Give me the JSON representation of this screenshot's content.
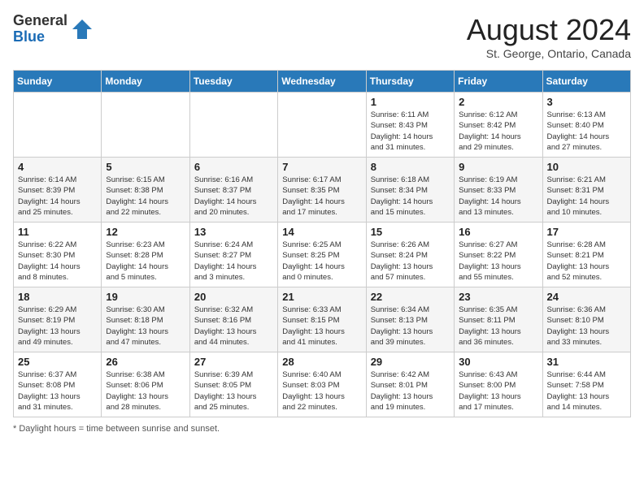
{
  "header": {
    "logo_general": "General",
    "logo_blue": "Blue",
    "month_title": "August 2024",
    "location": "St. George, Ontario, Canada"
  },
  "footer": {
    "note": "Daylight hours"
  },
  "days_of_week": [
    "Sunday",
    "Monday",
    "Tuesday",
    "Wednesday",
    "Thursday",
    "Friday",
    "Saturday"
  ],
  "weeks": [
    [
      {
        "day": "",
        "info": ""
      },
      {
        "day": "",
        "info": ""
      },
      {
        "day": "",
        "info": ""
      },
      {
        "day": "",
        "info": ""
      },
      {
        "day": "1",
        "info": "Sunrise: 6:11 AM\nSunset: 8:43 PM\nDaylight: 14 hours\nand 31 minutes."
      },
      {
        "day": "2",
        "info": "Sunrise: 6:12 AM\nSunset: 8:42 PM\nDaylight: 14 hours\nand 29 minutes."
      },
      {
        "day": "3",
        "info": "Sunrise: 6:13 AM\nSunset: 8:40 PM\nDaylight: 14 hours\nand 27 minutes."
      }
    ],
    [
      {
        "day": "4",
        "info": "Sunrise: 6:14 AM\nSunset: 8:39 PM\nDaylight: 14 hours\nand 25 minutes."
      },
      {
        "day": "5",
        "info": "Sunrise: 6:15 AM\nSunset: 8:38 PM\nDaylight: 14 hours\nand 22 minutes."
      },
      {
        "day": "6",
        "info": "Sunrise: 6:16 AM\nSunset: 8:37 PM\nDaylight: 14 hours\nand 20 minutes."
      },
      {
        "day": "7",
        "info": "Sunrise: 6:17 AM\nSunset: 8:35 PM\nDaylight: 14 hours\nand 17 minutes."
      },
      {
        "day": "8",
        "info": "Sunrise: 6:18 AM\nSunset: 8:34 PM\nDaylight: 14 hours\nand 15 minutes."
      },
      {
        "day": "9",
        "info": "Sunrise: 6:19 AM\nSunset: 8:33 PM\nDaylight: 14 hours\nand 13 minutes."
      },
      {
        "day": "10",
        "info": "Sunrise: 6:21 AM\nSunset: 8:31 PM\nDaylight: 14 hours\nand 10 minutes."
      }
    ],
    [
      {
        "day": "11",
        "info": "Sunrise: 6:22 AM\nSunset: 8:30 PM\nDaylight: 14 hours\nand 8 minutes."
      },
      {
        "day": "12",
        "info": "Sunrise: 6:23 AM\nSunset: 8:28 PM\nDaylight: 14 hours\nand 5 minutes."
      },
      {
        "day": "13",
        "info": "Sunrise: 6:24 AM\nSunset: 8:27 PM\nDaylight: 14 hours\nand 3 minutes."
      },
      {
        "day": "14",
        "info": "Sunrise: 6:25 AM\nSunset: 8:25 PM\nDaylight: 14 hours\nand 0 minutes."
      },
      {
        "day": "15",
        "info": "Sunrise: 6:26 AM\nSunset: 8:24 PM\nDaylight: 13 hours\nand 57 minutes."
      },
      {
        "day": "16",
        "info": "Sunrise: 6:27 AM\nSunset: 8:22 PM\nDaylight: 13 hours\nand 55 minutes."
      },
      {
        "day": "17",
        "info": "Sunrise: 6:28 AM\nSunset: 8:21 PM\nDaylight: 13 hours\nand 52 minutes."
      }
    ],
    [
      {
        "day": "18",
        "info": "Sunrise: 6:29 AM\nSunset: 8:19 PM\nDaylight: 13 hours\nand 49 minutes."
      },
      {
        "day": "19",
        "info": "Sunrise: 6:30 AM\nSunset: 8:18 PM\nDaylight: 13 hours\nand 47 minutes."
      },
      {
        "day": "20",
        "info": "Sunrise: 6:32 AM\nSunset: 8:16 PM\nDaylight: 13 hours\nand 44 minutes."
      },
      {
        "day": "21",
        "info": "Sunrise: 6:33 AM\nSunset: 8:15 PM\nDaylight: 13 hours\nand 41 minutes."
      },
      {
        "day": "22",
        "info": "Sunrise: 6:34 AM\nSunset: 8:13 PM\nDaylight: 13 hours\nand 39 minutes."
      },
      {
        "day": "23",
        "info": "Sunrise: 6:35 AM\nSunset: 8:11 PM\nDaylight: 13 hours\nand 36 minutes."
      },
      {
        "day": "24",
        "info": "Sunrise: 6:36 AM\nSunset: 8:10 PM\nDaylight: 13 hours\nand 33 minutes."
      }
    ],
    [
      {
        "day": "25",
        "info": "Sunrise: 6:37 AM\nSunset: 8:08 PM\nDaylight: 13 hours\nand 31 minutes."
      },
      {
        "day": "26",
        "info": "Sunrise: 6:38 AM\nSunset: 8:06 PM\nDaylight: 13 hours\nand 28 minutes."
      },
      {
        "day": "27",
        "info": "Sunrise: 6:39 AM\nSunset: 8:05 PM\nDaylight: 13 hours\nand 25 minutes."
      },
      {
        "day": "28",
        "info": "Sunrise: 6:40 AM\nSunset: 8:03 PM\nDaylight: 13 hours\nand 22 minutes."
      },
      {
        "day": "29",
        "info": "Sunrise: 6:42 AM\nSunset: 8:01 PM\nDaylight: 13 hours\nand 19 minutes."
      },
      {
        "day": "30",
        "info": "Sunrise: 6:43 AM\nSunset: 8:00 PM\nDaylight: 13 hours\nand 17 minutes."
      },
      {
        "day": "31",
        "info": "Sunrise: 6:44 AM\nSunset: 7:58 PM\nDaylight: 13 hours\nand 14 minutes."
      }
    ]
  ]
}
